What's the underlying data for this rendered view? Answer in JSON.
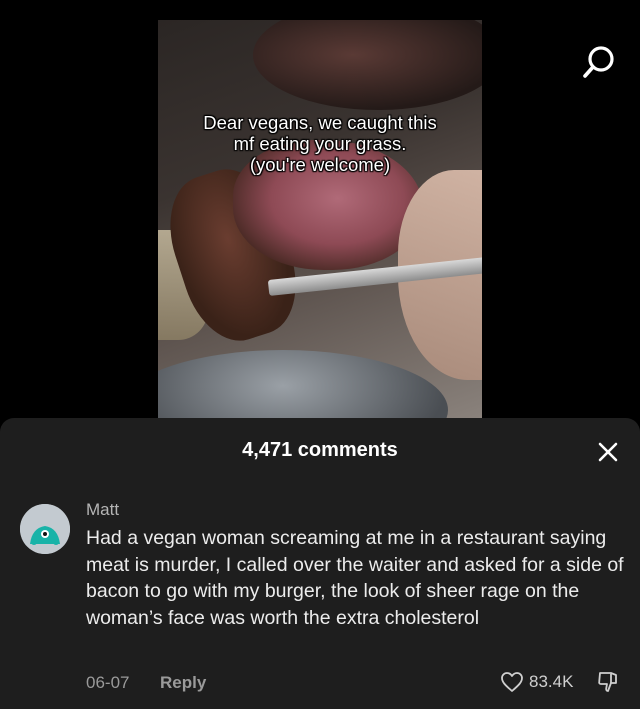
{
  "video": {
    "caption_lines": [
      "Dear vegans, we caught this",
      "mf eating your grass.",
      "(you're welcome)"
    ]
  },
  "comments_panel": {
    "count_label": "4,471 comments"
  },
  "comment": {
    "username": "Matt",
    "text": "Had a vegan woman screaming at me in a restaurant saying meat is murder, I called over the waiter and asked for a side of bacon to go with my burger, the look of sheer rage on the woman’s face was worth the extra cholesterol",
    "date": "06-07",
    "reply_label": "Reply",
    "like_count": "83.4K"
  },
  "icons": {
    "search": "search-icon",
    "close": "close-icon",
    "like": "heart-icon",
    "dislike": "thumbs-down-icon"
  }
}
